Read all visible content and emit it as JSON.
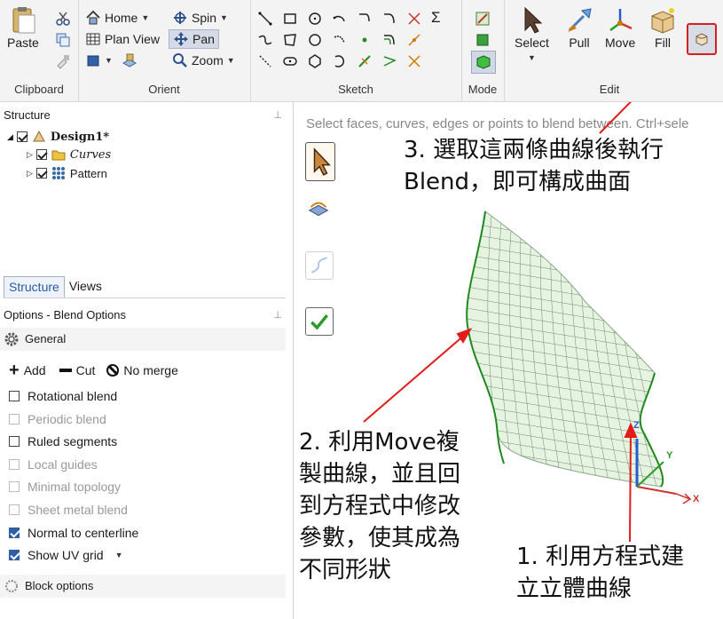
{
  "ribbon": {
    "clipboard": {
      "label": "Clipboard",
      "paste": "Paste"
    },
    "orient": {
      "label": "Orient",
      "home": "Home",
      "plan_view": "Plan View",
      "spin": "Spin",
      "pan": "Pan",
      "zoom": "Zoom"
    },
    "sketch": {
      "label": "Sketch",
      "sigma": "Σ"
    },
    "mode": {
      "label": "Mode"
    },
    "edit": {
      "label": "Edit",
      "select": "Select",
      "pull": "Pull",
      "move": "Move",
      "fill": "Fill"
    }
  },
  "structure": {
    "title": "Structure",
    "root": "Design1*",
    "children": [
      "Curves",
      "Pattern"
    ],
    "tabs": [
      "Structure",
      "Views"
    ]
  },
  "options": {
    "title": "Options - Blend Options",
    "general": "General",
    "add": "Add",
    "cut": "Cut",
    "no_merge": "No merge",
    "items": [
      {
        "label": "Rotational blend",
        "checked": false,
        "enabled": true
      },
      {
        "label": "Periodic blend",
        "checked": false,
        "enabled": false
      },
      {
        "label": "Ruled segments",
        "checked": false,
        "enabled": true
      },
      {
        "label": "Local guides",
        "checked": false,
        "enabled": false
      },
      {
        "label": "Minimal topology",
        "checked": false,
        "enabled": false
      },
      {
        "label": "Sheet metal blend",
        "checked": false,
        "enabled": false
      },
      {
        "label": "Normal to centerline",
        "checked": true,
        "enabled": true
      },
      {
        "label": "Show UV grid",
        "checked": true,
        "enabled": true
      }
    ],
    "block_options": "Block options"
  },
  "viewport": {
    "hint": "Select faces, curves, edges or points to blend between. Ctrl+sele",
    "axes": {
      "x": "X",
      "y": "Y",
      "z": "Z"
    },
    "annotation3": "3. 選取這兩條曲線後執行\nBlend，即可構成曲面",
    "annotation2": "2. 利用Move複\n製曲線，並且回\n到方程式中修改\n參數，使其成為\n不同形狀",
    "annotation1": "1. 利用方程式建\n立立體曲線"
  },
  "colors": {
    "annotation_arrow": "#e21b1b",
    "surface": "#e6f3e0",
    "surface_edge": "#1e8a1e",
    "mesh": "#6d8a6d",
    "accent": "#2f5ea8"
  }
}
